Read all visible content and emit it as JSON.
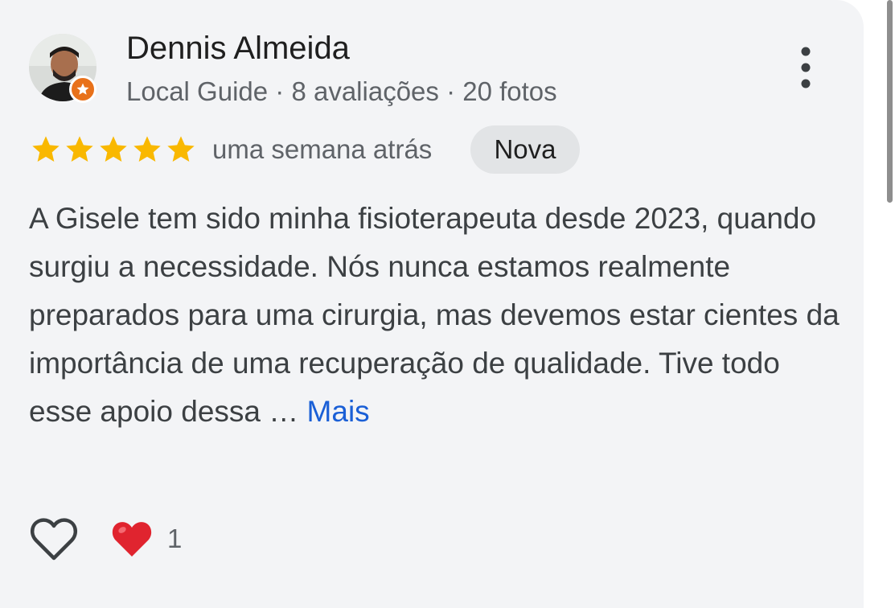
{
  "reviewer": {
    "name": "Dennis Almeida",
    "meta": "Local Guide · 8 avaliações · 20 fotos"
  },
  "review": {
    "rating": 5,
    "rating_max": 5,
    "date": "uma semana atrás",
    "badge": "Nova",
    "text": "A Gisele tem sido minha fisioterapeuta desde 2023, quando surgiu a necessidade. Nós nunca estamos realmente preparados para uma cirurgia, mas devemos estar cientes da importância de uma recuperação de qualidade. Tive todo esse apoio dessa …",
    "more_label": "Mais"
  },
  "reactions": {
    "count": "1"
  },
  "icons": {
    "menu": "more-vert-icon",
    "like": "heart-outline-icon",
    "reaction": "red-heart-icon",
    "guide": "local-guide-star-icon"
  },
  "colors": {
    "star": "#f9b800",
    "link": "#1a5fd6",
    "guide_badge": "#e8711a",
    "reaction_heart": "#e0242f"
  }
}
